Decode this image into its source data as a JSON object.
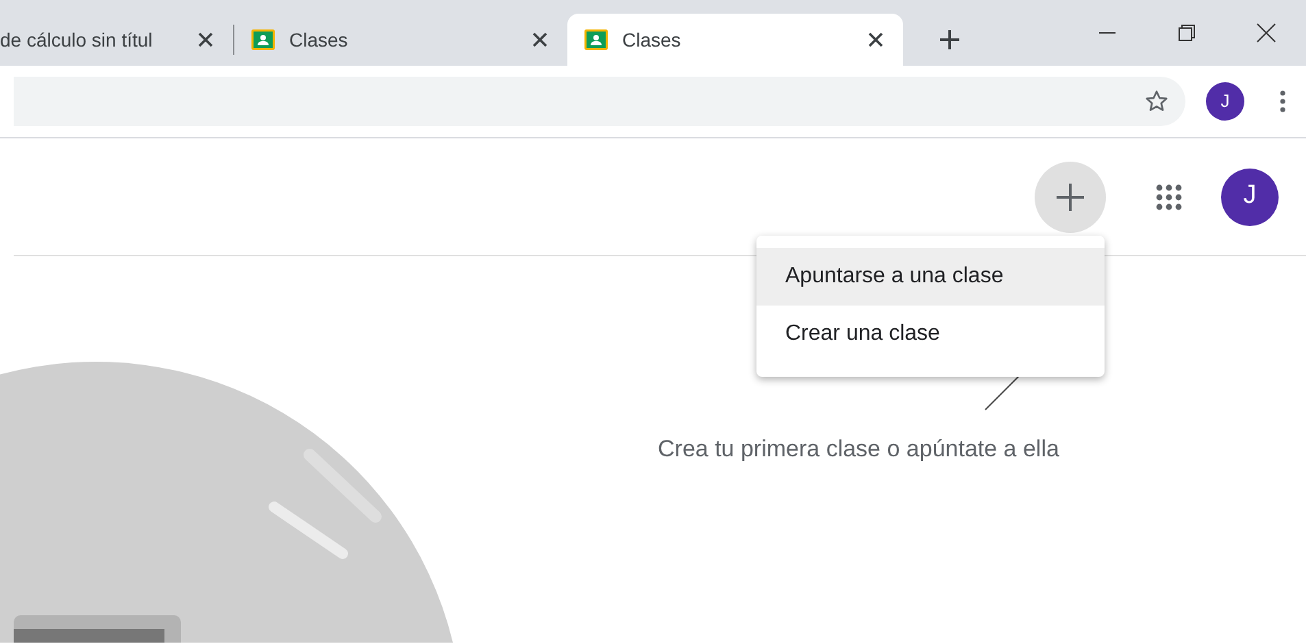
{
  "tabs": [
    {
      "title": "de cálculo sin títul",
      "selected": false,
      "favicon": false
    },
    {
      "title": "Clases",
      "selected": false,
      "favicon": true
    },
    {
      "title": "Clases",
      "selected": true,
      "favicon": true
    }
  ],
  "toolbar": {
    "avatar_letter": "J"
  },
  "header": {
    "avatar_letter": "J"
  },
  "add_menu": {
    "items": [
      {
        "label": "Apuntarse a una clase",
        "selected": true
      },
      {
        "label": "Crear una clase",
        "selected": false
      }
    ]
  },
  "empty_state": {
    "message": "Crea tu primera clase o apúntate a ella"
  }
}
